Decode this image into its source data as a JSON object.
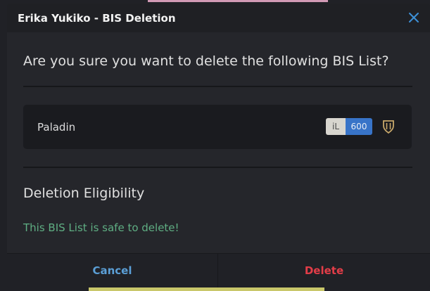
{
  "modal": {
    "title": "Erika Yukiko - BIS Deletion",
    "close_icon": "close-icon",
    "question": "Are you sure you want to delete the following BIS List?",
    "bis_item": {
      "name": "Paladin",
      "item_level_label": "iL",
      "item_level_value": "600",
      "role_icon": "paladin-job-icon"
    },
    "eligibility": {
      "title": "Deletion Eligibility",
      "status": "This BIS List is safe to delete!"
    },
    "buttons": {
      "cancel": "Cancel",
      "delete": "Delete"
    }
  },
  "colors": {
    "modal_bg": "#25262b",
    "header_bg": "#1f2024",
    "card_bg": "#1a1b1f",
    "accent_blue": "#3874c8",
    "safe_green": "#5fae83",
    "cancel_blue": "#5b9fd6",
    "delete_red": "#e33d48",
    "close_icon": "#3d8fd6"
  }
}
